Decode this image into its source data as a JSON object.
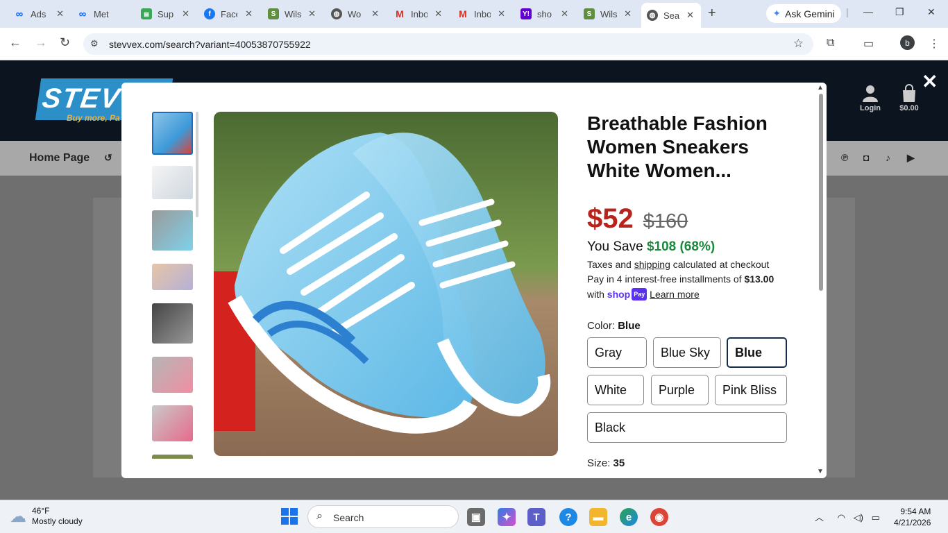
{
  "browser": {
    "tabs": [
      {
        "title": "Ads",
        "favicon": "meta-icon",
        "color": "#0866ff"
      },
      {
        "title": "Met",
        "favicon": "meta-icon",
        "color": "#0866ff"
      },
      {
        "title": "Sup",
        "favicon": "sheet-icon",
        "color": "#3aa757"
      },
      {
        "title": "Face",
        "favicon": "facebook-icon",
        "color": "#1877f2"
      },
      {
        "title": "Wils",
        "favicon": "shopify-icon",
        "color": "#5e8e3e"
      },
      {
        "title": "Wo",
        "favicon": "globe-icon",
        "color": "#555555"
      },
      {
        "title": "Inbo",
        "favicon": "gmail-icon",
        "color": "#d93025"
      },
      {
        "title": "Inbo",
        "favicon": "gmail-icon",
        "color": "#d93025"
      },
      {
        "title": "sho",
        "favicon": "yahoo-icon",
        "color": "#6001d2"
      },
      {
        "title": "Wils",
        "favicon": "shopify-icon",
        "color": "#5e8e3e"
      },
      {
        "title": "Sea",
        "favicon": "globe-icon",
        "color": "#555555"
      }
    ],
    "ask_gemini": "Ask Gemini",
    "url": "stevvex.com/search?variant=40053870755922",
    "profile_initial": "b"
  },
  "site": {
    "logo_text": "STEVV",
    "logo_tagline": "Buy more, Pa",
    "nav_home": "Home Page",
    "login_label": "Login",
    "cart_total": "$0.00",
    "social_icons": [
      "facebook-icon",
      "pinterest-icon",
      "instagram-icon",
      "tiktok-icon",
      "youtube-icon"
    ]
  },
  "product": {
    "title": "Breathable Fashion Women Sneakers White Women...",
    "price": "$52",
    "compare_price": "$160",
    "save_label": "You Save",
    "save_amount": "$108 (68%)",
    "tax_prefix": "Taxes and",
    "tax_link": "shipping",
    "tax_suffix": "calculated at checkout",
    "installments_prefix": "Pay in 4 interest-free installments of",
    "installment_amount": "$13.00",
    "with_label": "with",
    "shop_pay_label": "shop",
    "shop_pay_badge": "Pay",
    "learn_more": "Learn more",
    "color_label": "Color:",
    "color_selected": "Blue",
    "colors": [
      "Gray",
      "Blue Sky",
      "Blue",
      "White",
      "Purple",
      "Pink Bliss",
      "Black"
    ],
    "size_label": "Size:",
    "size_selected": "35",
    "thumbnail_count": 8,
    "selected_thumbnail": 1
  },
  "taskbar": {
    "temperature": "46°F",
    "weather": "Mostly cloudy",
    "search_placeholder": "Search",
    "time": "9:54 AM",
    "date": "4/21/2026"
  }
}
